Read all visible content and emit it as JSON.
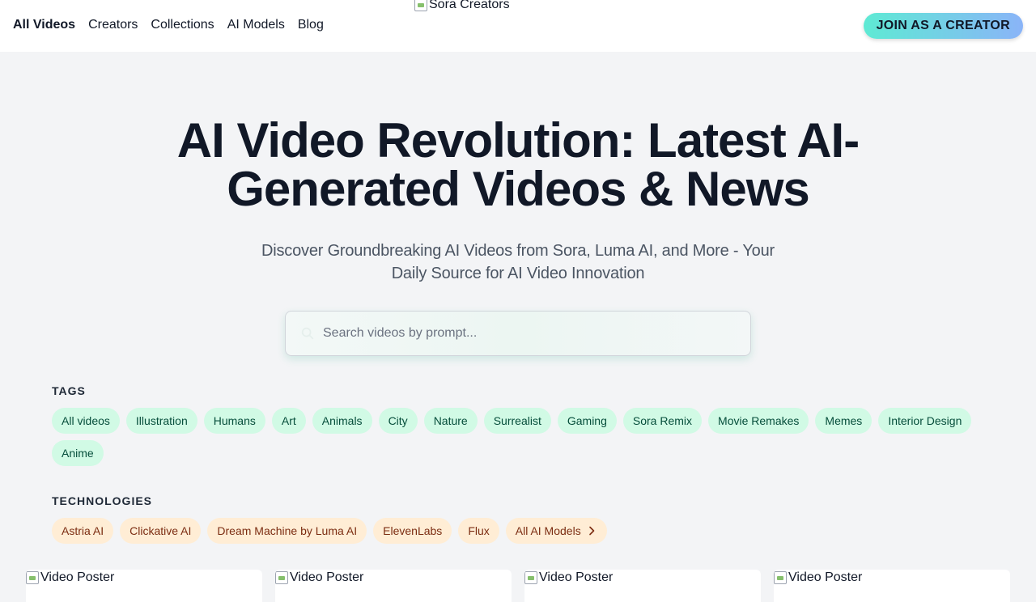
{
  "header": {
    "nav": [
      "All Videos",
      "Creators",
      "Collections",
      "AI Models",
      "Blog"
    ],
    "logo_alt": "Sora Creators",
    "join_label": "JOIN AS A CREATOR"
  },
  "hero": {
    "title": "AI Video Revolution: Latest AI-Generated Videos & News",
    "subtitle": "Discover Groundbreaking AI Videos from Sora, Luma AI, and More - Your Daily Source for AI Video Innovation"
  },
  "search": {
    "placeholder": "Search videos by prompt...",
    "value": ""
  },
  "tags": {
    "label": "TAGS",
    "items": [
      "All videos",
      "Illustration",
      "Humans",
      "Art",
      "Animals",
      "City",
      "Nature",
      "Surrealist",
      "Gaming",
      "Sora Remix",
      "Movie Remakes",
      "Memes",
      "Interior Design",
      "Anime"
    ]
  },
  "technologies": {
    "label": "TECHNOLOGIES",
    "items": [
      "Astria AI",
      "Clickative AI",
      "Dream Machine by Luma AI",
      "ElevenLabs",
      "Flux",
      "All AI Models"
    ]
  },
  "videos": {
    "poster_alt": "Video Poster",
    "count_visible": 4
  },
  "colors": {
    "accent_start": "#5eead4",
    "accent_end": "#8ab4f8",
    "tag_bg": "#d1fae5",
    "tech_bg": "#ffedd5"
  }
}
